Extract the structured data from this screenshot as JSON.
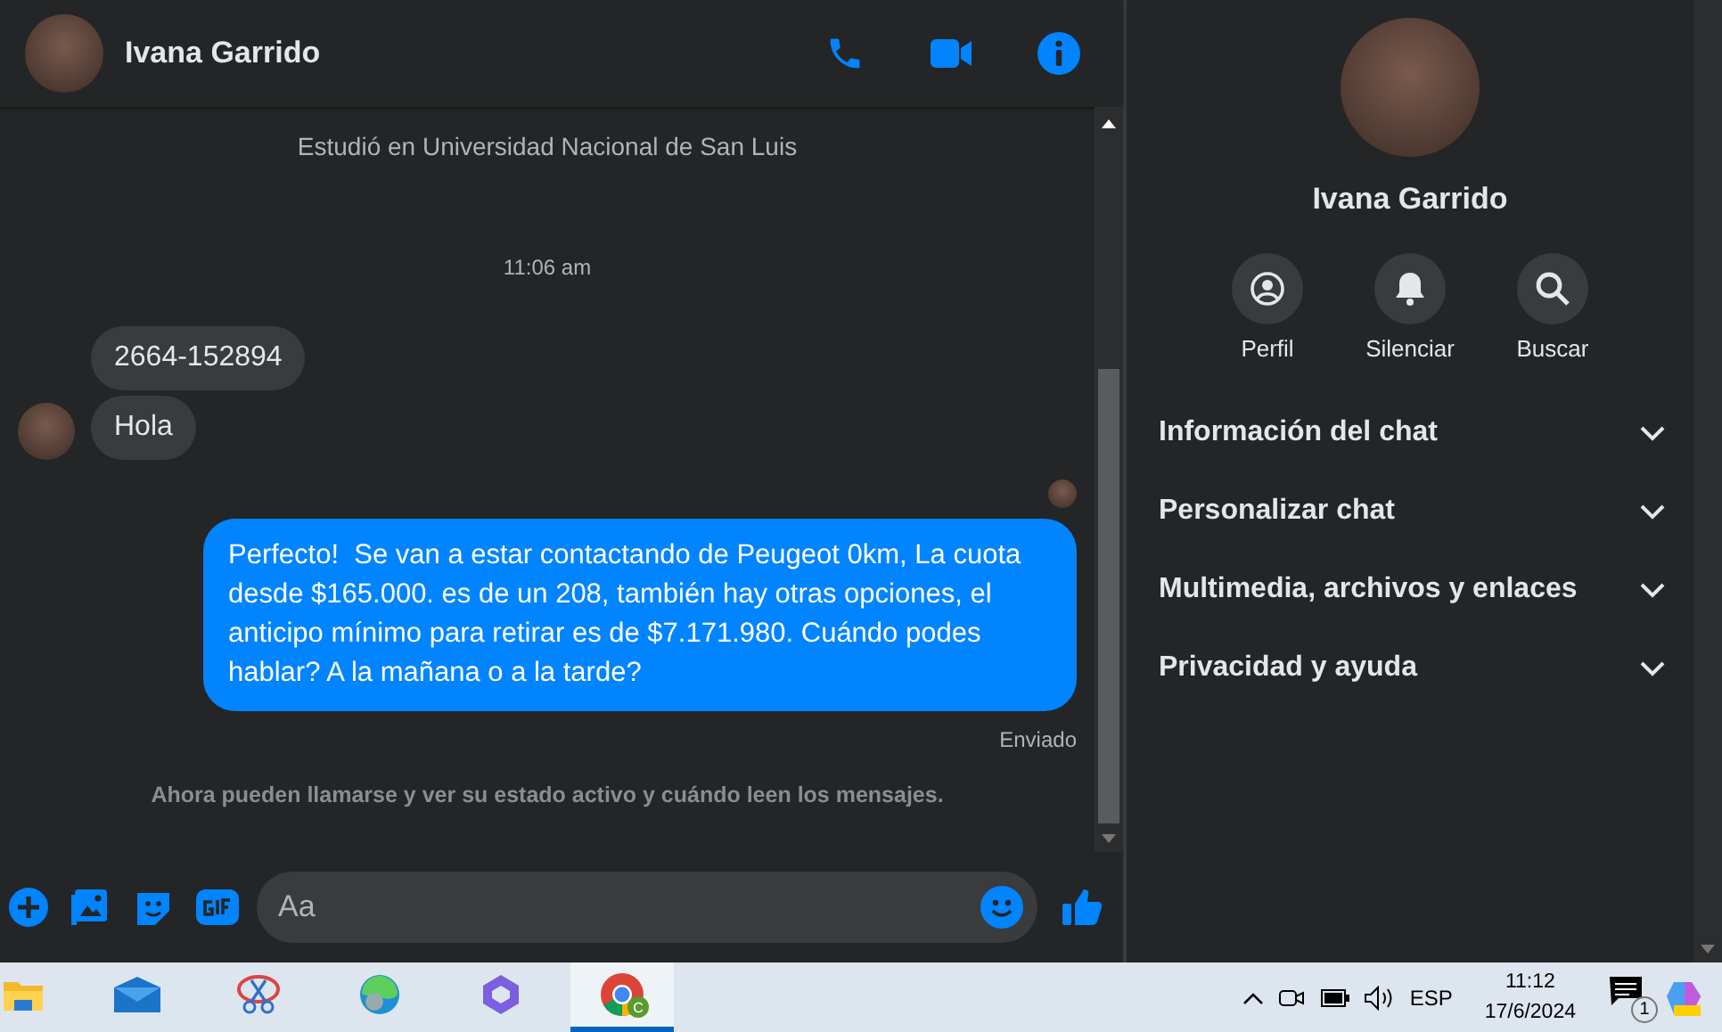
{
  "chat": {
    "contact_name": "Ivana Garrido",
    "intro_lines": [
      "Estudió en Universidad Nacional de San Luis"
    ],
    "timestamp": "11:06 am",
    "incoming": [
      "2664-152894",
      "Hola"
    ],
    "outgoing": "Perfecto!  Se van a estar contactando de Peugeot 0km, La cuota desde $165.000. es de un 208, también hay otras opciones, el anticipo mínimo para retirar es de $7.171.980. Cuándo podes hablar? A la mañana o a la tarde?",
    "status": "Enviado",
    "notice": "Ahora pueden llamarse y ver su estado activo y cuándo leen los mensajes.",
    "composer": {
      "placeholder": "Aa"
    }
  },
  "sidebar": {
    "name": "Ivana Garrido",
    "actions": [
      {
        "kind": "profile",
        "label": "Perfil"
      },
      {
        "kind": "bell",
        "label": "Silenciar"
      },
      {
        "kind": "search",
        "label": "Buscar"
      }
    ],
    "sections": [
      {
        "label": "Información del chat",
        "expanded": false
      },
      {
        "label": "Personalizar chat",
        "expanded": false
      },
      {
        "label": "Multimedia, archivos y enlaces",
        "expanded": false
      },
      {
        "label": "Privacidad y ayuda",
        "expanded": false
      }
    ]
  },
  "taskbar": {
    "apps": [
      {
        "kind": "folder",
        "selected": false
      },
      {
        "kind": "mail",
        "selected": false
      },
      {
        "kind": "scissors",
        "selected": false
      },
      {
        "kind": "edge",
        "selected": false
      },
      {
        "kind": "office",
        "selected": false
      },
      {
        "kind": "chrome",
        "selected": true,
        "badge": "C"
      }
    ],
    "language": "ESP",
    "time": "11:12",
    "date": "17/6/2024",
    "notifications": "1"
  }
}
